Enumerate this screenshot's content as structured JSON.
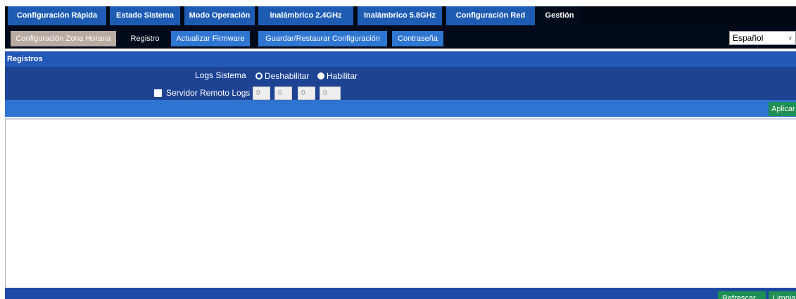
{
  "main_tabs": [
    {
      "label": "Configuración Rápida"
    },
    {
      "label": "Estado Sistema"
    },
    {
      "label": "Modo Operación"
    },
    {
      "label": "Inalámbrico 2.4GHz"
    },
    {
      "label": "Inalámbrico 5.8GHz"
    },
    {
      "label": "Configuración Red"
    },
    {
      "label": "Gestión"
    }
  ],
  "sub_tabs": [
    {
      "label": "Configuración Zona Horana"
    },
    {
      "label": "Registro"
    },
    {
      "label": "Actualizar Firmware"
    },
    {
      "label": "Guardar/Restaurar Configuración"
    },
    {
      "label": "Contraseña"
    }
  ],
  "language": {
    "selected": "Español"
  },
  "section": {
    "title": "Registros"
  },
  "form": {
    "logs_label": "Logs Sistema",
    "disable_label": "Deshabilitar",
    "enable_label": "Habilitar",
    "remote_label": "Servidor Remoto Logs",
    "ip": [
      "0",
      "0",
      "0",
      "0"
    ]
  },
  "buttons": {
    "apply": "Aplicar",
    "refresh": "Refrescar",
    "clear": "Limpiar"
  },
  "colors": {
    "nav_blue": "#1e5cb4",
    "accent_green": "#1e8f55",
    "panel_blue": "#1e4393"
  }
}
